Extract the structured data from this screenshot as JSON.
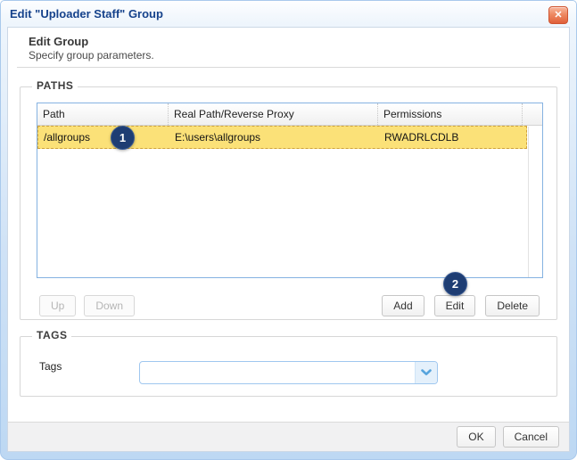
{
  "dialog": {
    "title": "Edit \"Uploader Staff\" Group"
  },
  "icons": {
    "close": "✕"
  },
  "intro": {
    "heading": "Edit Group",
    "subheading": "Specify group parameters."
  },
  "paths_section": {
    "legend": "PATHS",
    "table": {
      "columns": [
        "Path",
        "Real Path/Reverse Proxy",
        "Permissions"
      ],
      "rows": [
        {
          "path": "/allgroups",
          "real_path": "E:\\users\\allgroups",
          "permissions": "RWADRLCDLB",
          "selected": true
        }
      ]
    },
    "buttons": {
      "up": "Up",
      "down": "Down",
      "add": "Add",
      "edit": "Edit",
      "delete": "Delete"
    },
    "annotations": {
      "step1": "1",
      "step2": "2"
    }
  },
  "tags_section": {
    "legend": "TAGS",
    "label": "Tags",
    "value": ""
  },
  "footer": {
    "ok": "OK",
    "cancel": "Cancel"
  },
  "colors": {
    "title_text": "#15428b",
    "selected_row": "#fbe178",
    "badge": "#1e3d73",
    "grid_border": "#85b2e1",
    "close_button": "#e0603a"
  }
}
